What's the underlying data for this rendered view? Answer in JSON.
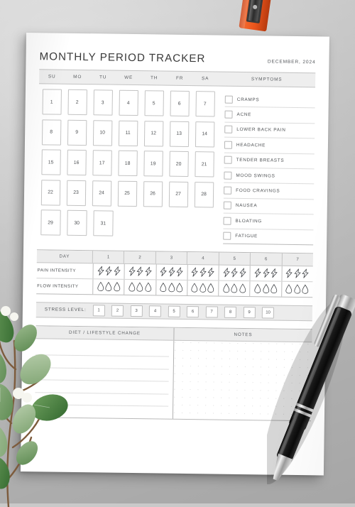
{
  "document": {
    "title": "MONTHLY PERIOD TRACKER",
    "date": "DECEMBER, 2024"
  },
  "calendar": {
    "weekday_headers": [
      "SU",
      "MO",
      "TU",
      "WE",
      "TH",
      "FR",
      "SA"
    ],
    "days": [
      [
        1,
        2,
        3,
        4,
        5,
        6,
        7
      ],
      [
        8,
        9,
        10,
        11,
        12,
        13,
        14
      ],
      [
        15,
        16,
        17,
        18,
        19,
        20,
        21
      ],
      [
        22,
        23,
        24,
        25,
        26,
        27,
        28
      ],
      [
        29,
        30,
        31,
        null,
        null,
        null,
        null
      ]
    ]
  },
  "symptoms": {
    "header": "SYMPTOMS",
    "items": [
      {
        "label": "CRAMPS",
        "checked": false
      },
      {
        "label": "ACNE",
        "checked": false
      },
      {
        "label": "LOWER BACK PAIN",
        "checked": false
      },
      {
        "label": "HEADACHE",
        "checked": false
      },
      {
        "label": "TENDER BREASTS",
        "checked": false
      },
      {
        "label": "MOOD SWINGS",
        "checked": false
      },
      {
        "label": "FOOD CRAVINGS",
        "checked": false
      },
      {
        "label": "NAUSEA",
        "checked": false
      },
      {
        "label": "BLOATING",
        "checked": false
      },
      {
        "label": "FATIGUE",
        "checked": false
      }
    ]
  },
  "intensity": {
    "day_label": "DAY",
    "days": [
      1,
      2,
      3,
      4,
      5,
      6,
      7
    ],
    "rows": [
      {
        "label": "PAIN INTENSITY",
        "icon": "lightning-icon",
        "icons_per_cell": 3
      },
      {
        "label": "FLOW INTENSITY",
        "icon": "droplet-icon",
        "icons_per_cell": 3
      }
    ]
  },
  "stress": {
    "label": "STRESS LEVEL:",
    "levels": [
      1,
      2,
      3,
      4,
      5,
      6,
      7,
      8,
      9,
      10
    ]
  },
  "bottom": {
    "diet_header": "DIET / LIFESTYLE CHANGE",
    "notes_header": "NOTES",
    "diet_lines": 5
  },
  "props": {
    "sharpener_color": "#e8561f",
    "pen_color": "#141414",
    "plant_color": "#6f9b62"
  },
  "colors": {
    "paper": "#ffffff",
    "band": "#ececec",
    "border": "#c4c4c4",
    "text": "#4f5255",
    "backdrop": "#c8c8c8"
  }
}
